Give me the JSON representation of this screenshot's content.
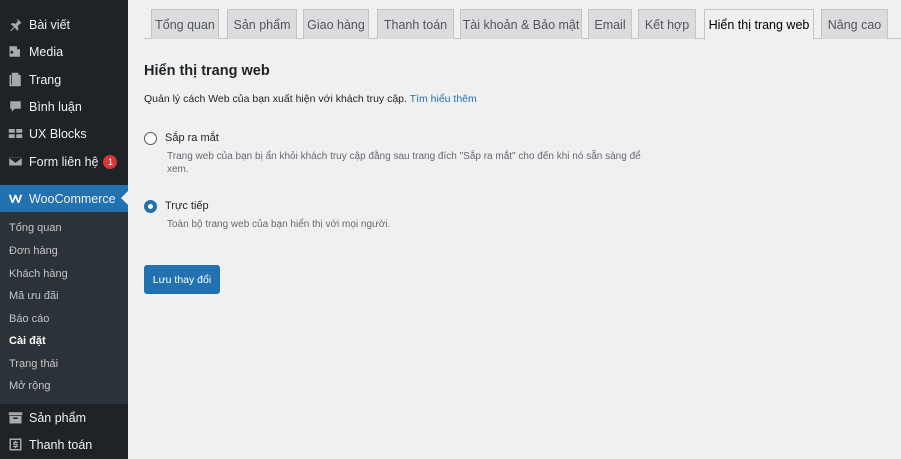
{
  "sidebar": {
    "items": [
      {
        "label": "Bài viết",
        "icon": "pin-icon"
      },
      {
        "label": "Media",
        "icon": "media-icon"
      },
      {
        "label": "Trang",
        "icon": "page-icon"
      },
      {
        "label": "Bình luận",
        "icon": "comment-icon"
      },
      {
        "label": "UX Blocks",
        "icon": "blocks-icon"
      },
      {
        "label": "Form liên hệ",
        "icon": "mail-icon",
        "badge": "1"
      },
      {
        "label": "WooCommerce",
        "icon": "woo-icon"
      },
      {
        "label": "Sản phẩm",
        "icon": "archive-icon"
      },
      {
        "label": "Thanh toán",
        "icon": "dollar-icon"
      }
    ],
    "submenu": [
      "Tổng quan",
      "Đơn hàng",
      "Khách hàng",
      "Mã ưu đãi",
      "Báo cáo",
      "Cài đặt",
      "Trạng thái",
      "Mở rộng"
    ]
  },
  "tabs": [
    "Tổng quan",
    "Sản phẩm",
    "Giao hàng",
    "Thanh toán",
    "Tài khoản & Bảo mật",
    "Email",
    "Kết hợp",
    "Hiển thị trang web",
    "Nâng cao"
  ],
  "main": {
    "title": "Hiển thị trang web",
    "description": "Quản lý cách Web của bạn xuất hiện với khách truy cập. ",
    "learn_more": "Tìm hiểu thêm",
    "options": [
      {
        "label": "Sắp ra mắt",
        "description": "Trang web của bạn bị ẩn khỏi khách truy cập đằng sau trang đích \"Sắp ra mắt\" cho đến khi nó sẵn sàng để xem.",
        "checked": false
      },
      {
        "label": "Trực tiếp",
        "description": "Toàn bộ trang web của bạn hiển thị với mọi người.",
        "checked": true
      }
    ],
    "save_label": "Lưu thay đổi"
  },
  "colors": {
    "sidebar_bg": "#1d2327",
    "accent": "#2271b1",
    "badge": "#d63638"
  }
}
